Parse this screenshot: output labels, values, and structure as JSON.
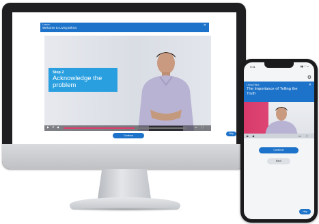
{
  "desktop": {
    "header": {
      "kicker": "Lesson",
      "title": "Welcome to Living Ethics",
      "close_icon": "close-icon"
    },
    "video": {
      "overlay_step": "Step 2",
      "overlay_headline": "Acknowledge the problem",
      "progress_fraction": 0.58,
      "controls_icons": [
        "play-icon",
        "skip-back-icon",
        "volume-icon",
        "captions-icon",
        "fullscreen-icon"
      ]
    },
    "continue_label": "Continue",
    "help_label": "Help",
    "settings_icon": "gear-icon"
  },
  "phone": {
    "time": "9:41",
    "status": "▮▮ ◠ ▭",
    "header": {
      "kicker": "Living Ethics",
      "title": "The Importance of Telling the Truth",
      "close_icon": "close-icon"
    },
    "video": {
      "accent_color": "#d83a6a",
      "controls_icons": [
        "play-icon",
        "volume-icon",
        "captions-icon",
        "fullscreen-icon"
      ]
    },
    "continue_label": "Continue",
    "back_label": "Back",
    "help_label": "Help",
    "settings_icon": "gear-icon"
  },
  "colors": {
    "brand_blue": "#1d73c9",
    "overlay_blue": "#2a9fe0",
    "progress_pink": "#e23b6b"
  }
}
